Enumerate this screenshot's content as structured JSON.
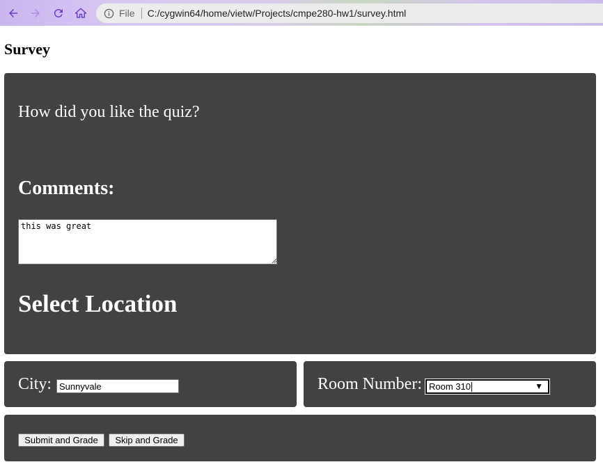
{
  "browser": {
    "scheme_label": "File",
    "url": "C:/cygwin64/home/vietw/Projects/cmpe280-hw1/survey.html"
  },
  "page": {
    "title": "Survey",
    "question": "How did you like the quiz?",
    "comments_heading": "Comments:",
    "comments_value": "this was great",
    "location_heading": "Select Location",
    "city_label": "City:",
    "city_value": "Sunnyvale",
    "room_label": "Room Number:",
    "room_selected": "Room 310",
    "submit_label": "Submit and Grade",
    "skip_label": "Skip and Grade"
  },
  "colors": {
    "panel_bg": "#424242",
    "nav_icon": "#6b3fc7"
  }
}
